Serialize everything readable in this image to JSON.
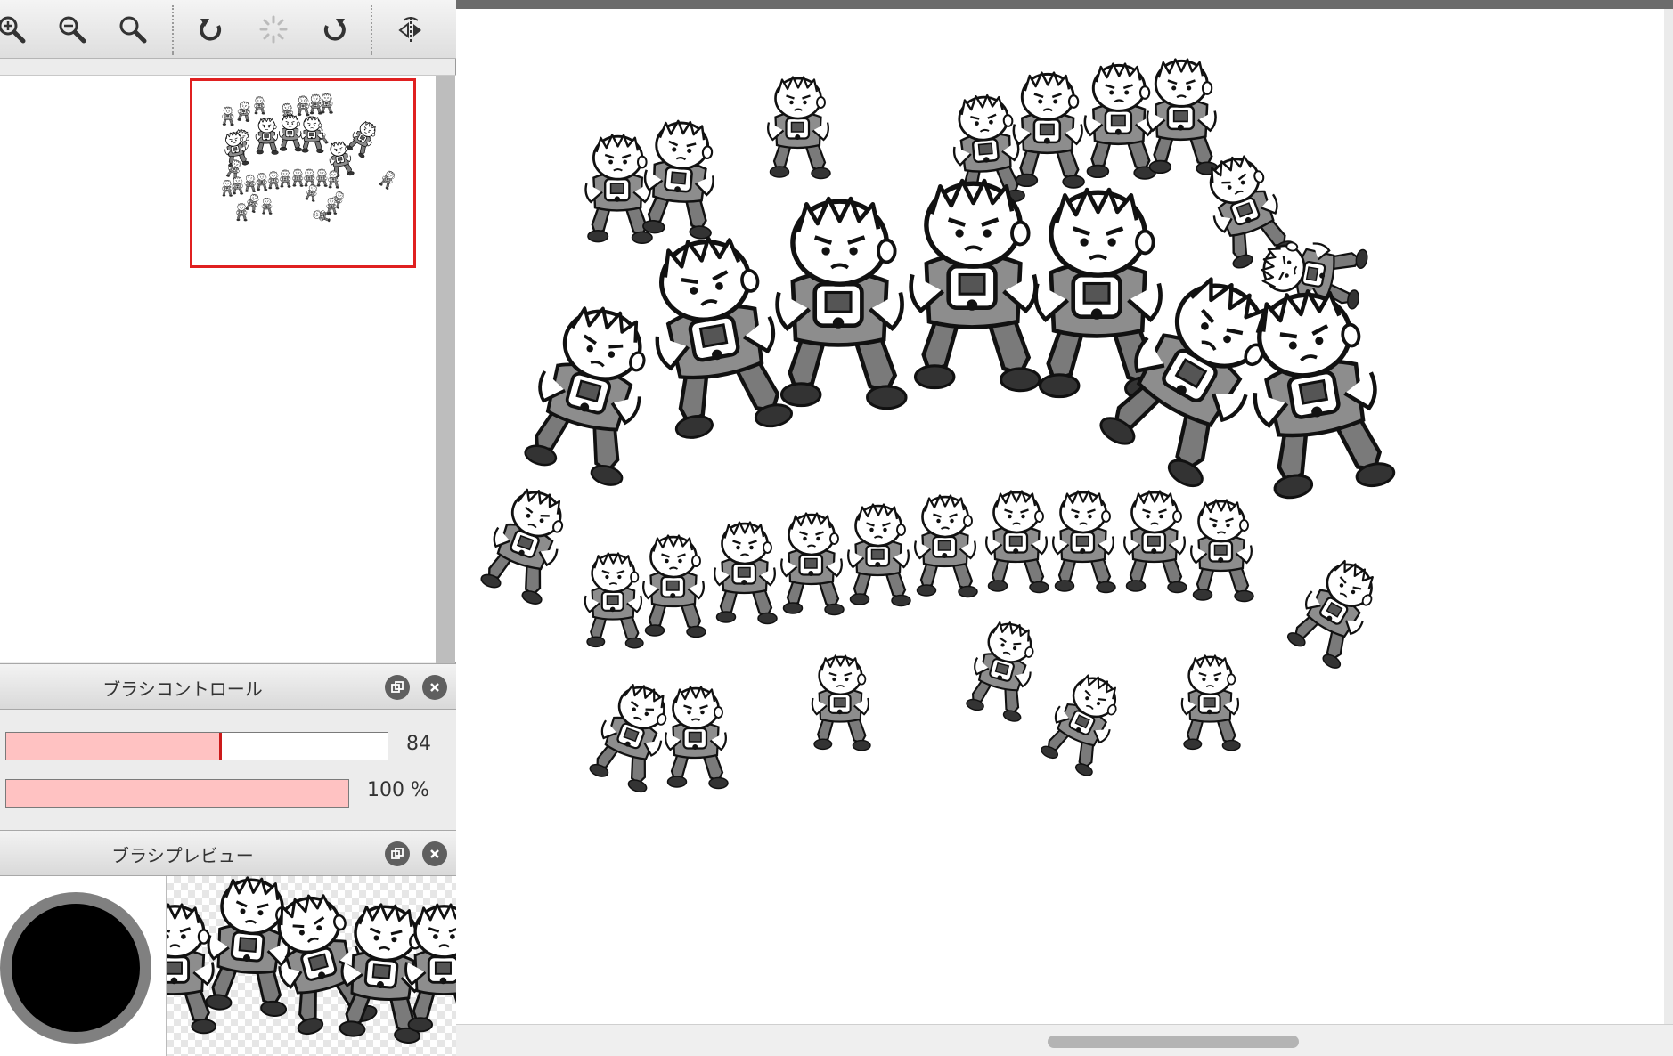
{
  "toolbar": {
    "buttons": [
      {
        "name": "zoom-in",
        "icon": "magnifier-plus-icon"
      },
      {
        "name": "zoom-out",
        "icon": "magnifier-minus-icon"
      },
      {
        "name": "zoom-reset",
        "icon": "magnifier-icon"
      },
      {
        "name": "rotate-left",
        "icon": "rotate-ccw-icon"
      },
      {
        "name": "rotate-reset",
        "icon": "spinner-icon"
      },
      {
        "name": "rotate-right",
        "icon": "rotate-cw-icon"
      },
      {
        "name": "flip-horizontal",
        "icon": "flip-horizontal-icon"
      }
    ]
  },
  "brush_control": {
    "title": "ブラシコントロール",
    "size_value": "84",
    "size_fraction": 0.56,
    "opacity_value": "100 %",
    "opacity_fraction": 1.0
  },
  "brush_preview": {
    "title": "ブラシプレビュー"
  },
  "colors": {
    "slider_fill": "#ffc2c2",
    "slider_marker": "#cc1a1a",
    "navigator_frame": "#e02020"
  }
}
